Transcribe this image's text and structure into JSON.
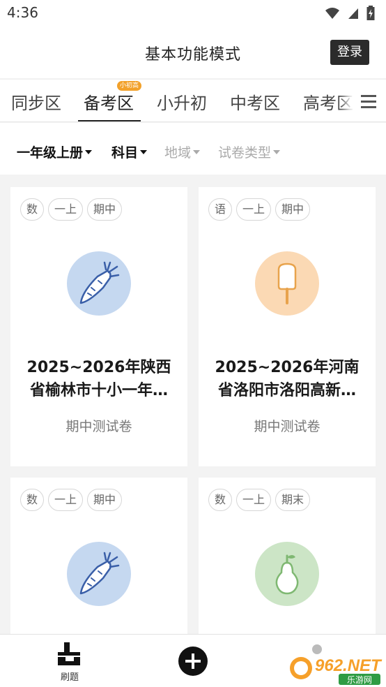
{
  "status_bar": {
    "time": "4:36"
  },
  "header": {
    "title": "基本功能模式",
    "login_label": "登录"
  },
  "tabs": [
    {
      "label": "同步区"
    },
    {
      "label": "备考区",
      "badge": "小初高",
      "active": true
    },
    {
      "label": "小升初"
    },
    {
      "label": "中考区"
    },
    {
      "label": "高考区"
    }
  ],
  "filters": [
    {
      "label": "一年级上册",
      "active": true
    },
    {
      "label": "科目",
      "active": true
    },
    {
      "label": "地域",
      "active": false
    },
    {
      "label": "试卷类型",
      "active": false
    }
  ],
  "cards": [
    {
      "tags": [
        "数",
        "一上",
        "期中"
      ],
      "icon": "carrot-icon",
      "circle_color": "#c5d8f0",
      "name_line1": "2025~2026年陕西",
      "name_line2": "省榆林市十小一年…",
      "type": "期中测试卷"
    },
    {
      "tags": [
        "语",
        "一上",
        "期中"
      ],
      "icon": "popsicle-icon",
      "circle_color": "#fbd9b4",
      "name_line1": "2025~2026年河南",
      "name_line2": "省洛阳市洛阳高新…",
      "type": "期中测试卷"
    },
    {
      "tags": [
        "数",
        "一上",
        "期中"
      ],
      "icon": "carrot-icon",
      "circle_color": "#c5d8f0",
      "name_line1": "",
      "name_line2": "",
      "type": ""
    },
    {
      "tags": [
        "数",
        "一上",
        "期末"
      ],
      "icon": "pear-icon",
      "circle_color": "#cce5c6",
      "name_line1": "",
      "name_line2": "",
      "type": ""
    }
  ],
  "bottom_nav": {
    "practice_label": "刷题",
    "add_icon": "plus-circle-icon"
  },
  "watermark": {
    "text_top": "962.NET",
    "text_bottom": "乐游网"
  }
}
